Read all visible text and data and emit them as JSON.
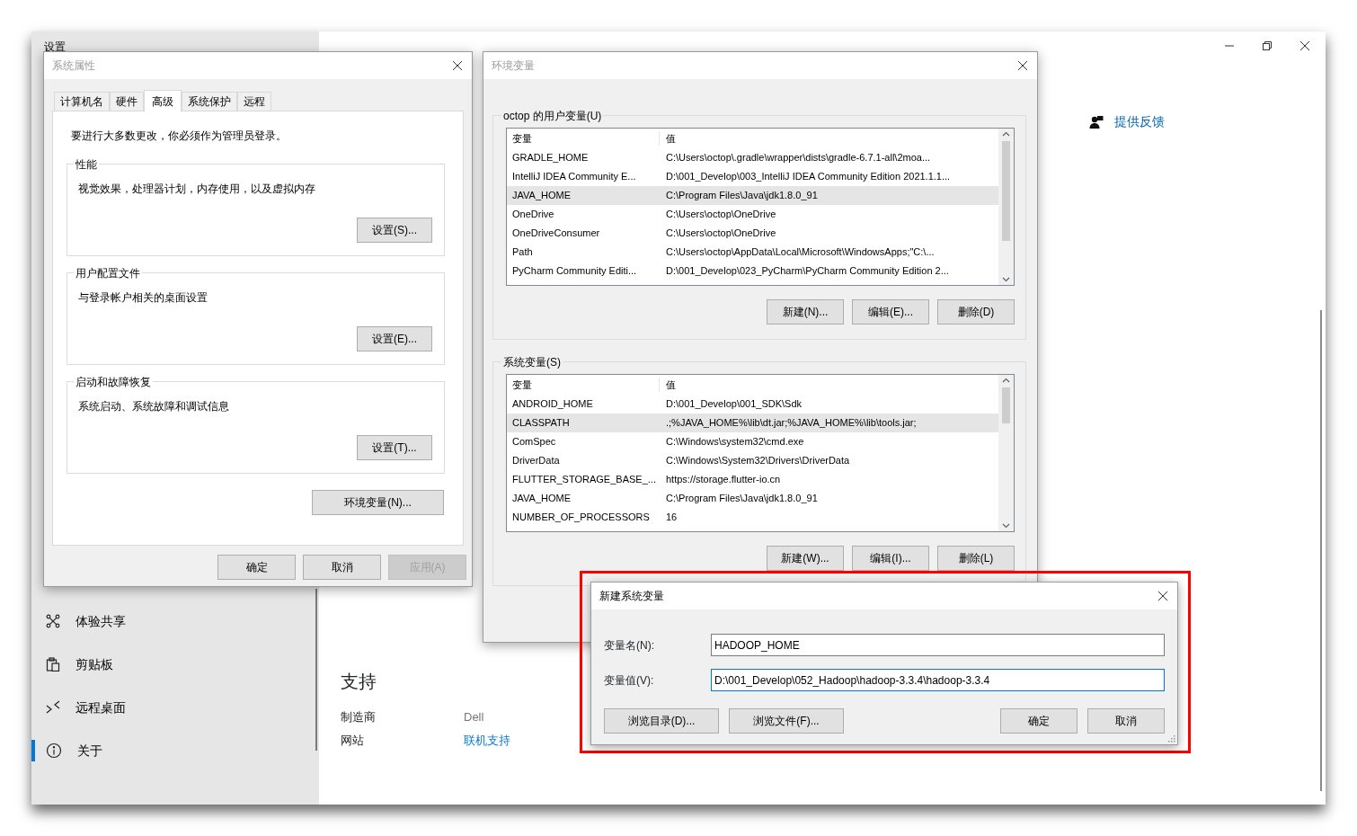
{
  "settings": {
    "title": "设置",
    "nav": [
      {
        "label": "体验共享",
        "selected": false
      },
      {
        "label": "剪贴板",
        "selected": false
      },
      {
        "label": "远程桌面",
        "selected": false
      },
      {
        "label": "关于",
        "selected": true
      }
    ],
    "feedback": "提供反馈",
    "support": {
      "heading": "支持",
      "rows": [
        {
          "label": "制造商",
          "value": "Dell",
          "kind": "text"
        },
        {
          "label": "网站",
          "value": "联机支持",
          "kind": "link"
        }
      ]
    }
  },
  "system_properties": {
    "title": "系统属性",
    "active": false,
    "tabs": [
      {
        "label": "计算机名",
        "selected": false
      },
      {
        "label": "硬件",
        "selected": false
      },
      {
        "label": "高级",
        "selected": true
      },
      {
        "label": "系统保护",
        "selected": false
      },
      {
        "label": "远程",
        "selected": false
      }
    ],
    "note": "要进行大多数更改，你必须作为管理员登录。",
    "groups": [
      {
        "title": "性能",
        "description": "视觉效果，处理器计划，内存使用，以及虚拟内存",
        "button": "设置(S)..."
      },
      {
        "title": "用户配置文件",
        "description": "与登录帐户相关的桌面设置",
        "button": "设置(E)..."
      },
      {
        "title": "启动和故障恢复",
        "description": "系统启动、系统故障和调试信息",
        "button": "设置(T)..."
      }
    ],
    "env_button": "环境变量(N)...",
    "buttons": [
      {
        "label": "确定",
        "disabled": false
      },
      {
        "label": "取消",
        "disabled": false
      },
      {
        "label": "应用(A)",
        "disabled": true
      }
    ]
  },
  "environment_variables": {
    "title": "环境变量",
    "active": false,
    "sections": [
      {
        "title": "octop 的用户变量(U)",
        "columns": [
          "变量",
          "值"
        ],
        "rows": [
          {
            "name": "GRADLE_HOME",
            "value": "C:\\Users\\octop\\.gradle\\wrapper\\dists\\gradle-6.7.1-all\\2moa...",
            "selected": false
          },
          {
            "name": "IntelliJ IDEA Community E...",
            "value": "D:\\001_Develop\\003_IntelliJ IDEA Community Edition 2021.1.1...",
            "selected": false
          },
          {
            "name": "JAVA_HOME",
            "value": "C:\\Program Files\\Java\\jdk1.8.0_91",
            "selected": true
          },
          {
            "name": "OneDrive",
            "value": "C:\\Users\\octop\\OneDrive",
            "selected": false
          },
          {
            "name": "OneDriveConsumer",
            "value": "C:\\Users\\octop\\OneDrive",
            "selected": false
          },
          {
            "name": "Path",
            "value": "C:\\Users\\octop\\AppData\\Local\\Microsoft\\WindowsApps;\"C:\\...",
            "selected": false
          },
          {
            "name": "PyCharm Community Editi...",
            "value": "D:\\001_Develop\\023_PyCharm\\PyCharm Community Edition 2...",
            "selected": false
          }
        ],
        "buttons": [
          "新建(N)...",
          "编辑(E)...",
          "删除(D)"
        ]
      },
      {
        "title": "系统变量(S)",
        "columns": [
          "变量",
          "值"
        ],
        "rows": [
          {
            "name": "ANDROID_HOME",
            "value": "D:\\001_Develop\\001_SDK\\Sdk",
            "selected": false
          },
          {
            "name": "CLASSPATH",
            "value": ".;%JAVA_HOME%\\lib\\dt.jar;%JAVA_HOME%\\lib\\tools.jar;",
            "selected": true
          },
          {
            "name": "ComSpec",
            "value": "C:\\Windows\\system32\\cmd.exe",
            "selected": false
          },
          {
            "name": "DriverData",
            "value": "C:\\Windows\\System32\\Drivers\\DriverData",
            "selected": false
          },
          {
            "name": "FLUTTER_STORAGE_BASE_...",
            "value": "https://storage.flutter-io.cn",
            "selected": false
          },
          {
            "name": "JAVA_HOME",
            "value": "C:\\Program Files\\Java\\jdk1.8.0_91",
            "selected": false
          },
          {
            "name": "NUMBER_OF_PROCESSORS",
            "value": "16",
            "selected": false
          }
        ],
        "buttons": [
          "新建(W)...",
          "编辑(I)...",
          "删除(L)"
        ]
      }
    ]
  },
  "new_variable": {
    "title": "新建系统变量",
    "active": true,
    "highlighted": true,
    "fields": [
      {
        "label": "变量名(N):",
        "value": "HADOOP_HOME",
        "focused": false
      },
      {
        "label": "变量值(V):",
        "value": "D:\\001_Develop\\052_Hadoop\\hadoop-3.3.4\\hadoop-3.3.4",
        "focused": true
      }
    ],
    "browse_buttons": [
      "浏览目录(D)...",
      "浏览文件(F)..."
    ],
    "buttons": [
      "确定",
      "取消"
    ]
  }
}
